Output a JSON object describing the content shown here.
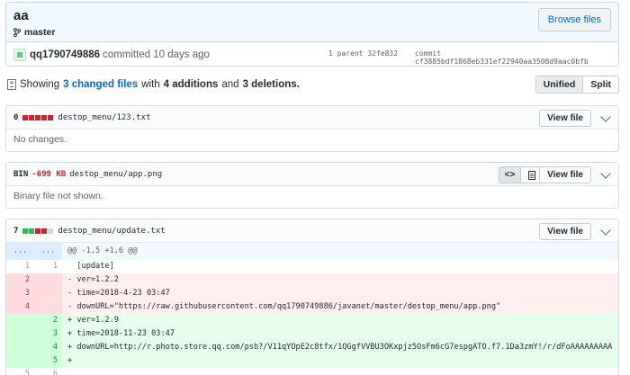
{
  "commit": {
    "title": "aa",
    "branch": "master",
    "browse_files_label": "Browse files",
    "author": "qq1790749886",
    "committed_text": "committed 10 days ago",
    "parent_text": "1 parent 32fe832",
    "commit_text": "commit cf3885bdf1868eb331ef22940aa3508d9aac0bfb"
  },
  "toc": {
    "showing": "Showing",
    "changed_files": "3 changed files",
    "with": "with",
    "additions": "4 additions",
    "and": "and",
    "deletions": "3 deletions.",
    "unified_label": "Unified",
    "split_label": "Split"
  },
  "files": [
    {
      "stat": "0",
      "name": "destop_menu/123.txt",
      "view_label": "View file",
      "body": "No changes."
    },
    {
      "stat": "BIN",
      "size": "-699 KB",
      "name": "destop_menu/app.png",
      "view_label": "View file",
      "body": "Binary file not shown."
    },
    {
      "stat": "7",
      "name": "destop_menu/update.txt",
      "view_label": "View file",
      "hunk": "@@ -1,5 +1,6 @@",
      "hunk_left": "...",
      "hunk_right": "...",
      "lines": [
        {
          "type": "ctx",
          "old": "1",
          "new": "1",
          "text": "  [update]"
        },
        {
          "type": "del",
          "old": "2",
          "new": "",
          "text": "- ver=1.2.2"
        },
        {
          "type": "del",
          "old": "3",
          "new": "",
          "text": "- time=2018-4-23 03:47"
        },
        {
          "type": "del",
          "old": "4",
          "new": "",
          "text": "- downURL=\"https://raw.githubusercontent.com/qq1790749886/javanet/master/destop_menu/app.png\""
        },
        {
          "type": "add",
          "old": "",
          "new": "2",
          "text": "+ ver=1.2.9"
        },
        {
          "type": "add",
          "old": "",
          "new": "3",
          "text": "+ time=2018-11-23 03:47"
        },
        {
          "type": "add",
          "old": "",
          "new": "4",
          "text": "+ downURL=http://r.photo.store.qq.com/psb?/V11qYOpE2c8tfx/1QGgfVVBU3OKxpjz5OsFm6cG7espgATO.f7.1Da3zmY!/r/dFoAAAAAAAAA"
        },
        {
          "type": "add",
          "old": "",
          "new": "5",
          "text": "+ "
        },
        {
          "type": "ctx",
          "old": "5",
          "new": "6",
          "text": ""
        }
      ]
    }
  ],
  "colors": {
    "accent": "#0366d6",
    "deletion": "#cb2431",
    "addition": "#2cbe4e"
  }
}
